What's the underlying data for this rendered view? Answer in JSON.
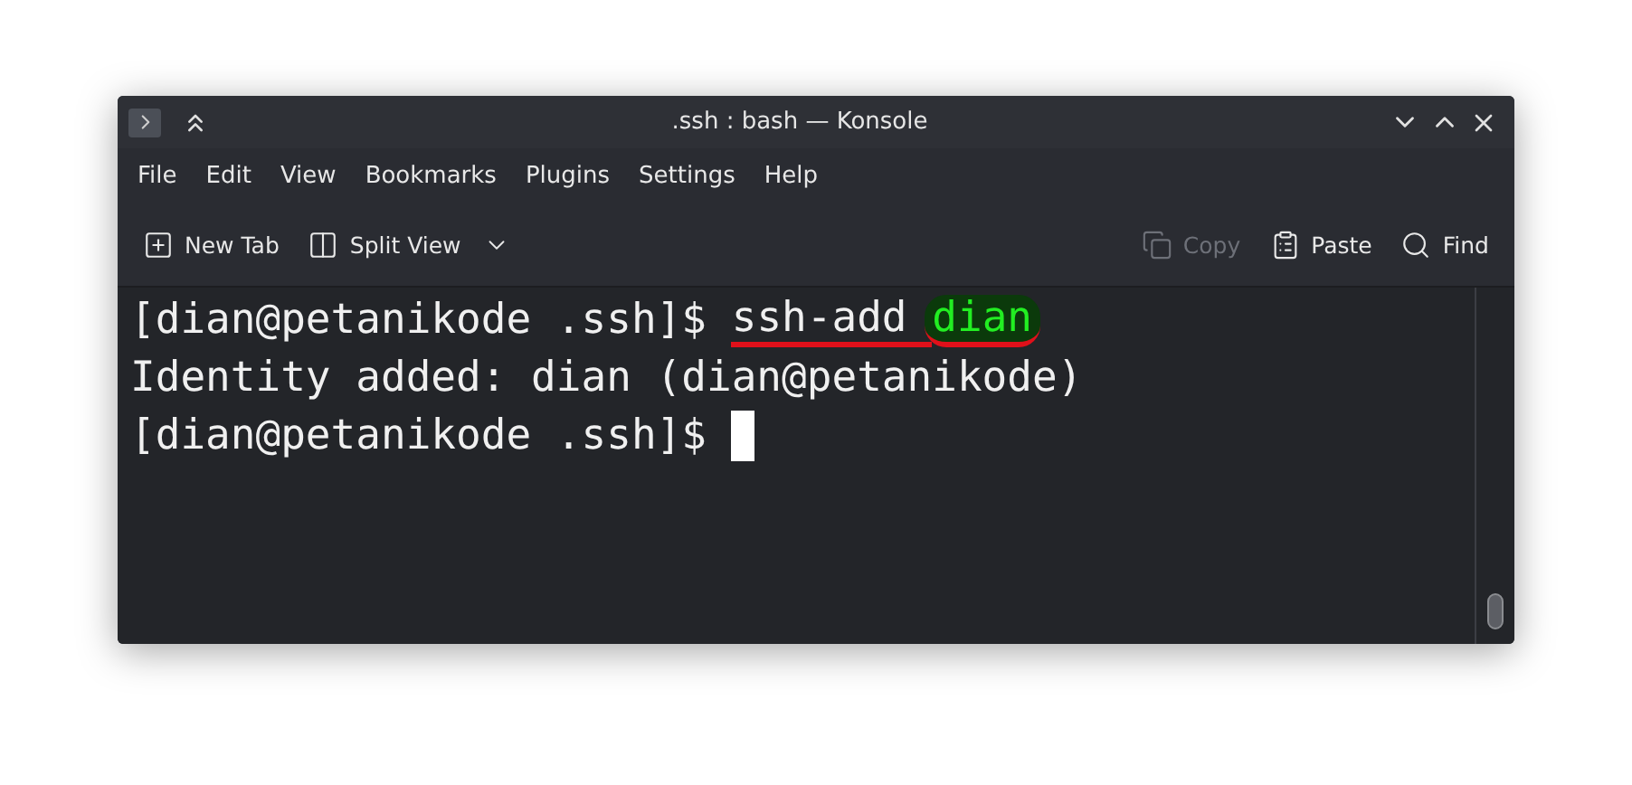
{
  "window": {
    "title": ".ssh : bash — Konsole"
  },
  "menu": [
    "File",
    "Edit",
    "View",
    "Bookmarks",
    "Plugins",
    "Settings",
    "Help"
  ],
  "toolbar_left": [
    {
      "kind": "new-tab",
      "label": "New Tab",
      "disabled": false
    },
    {
      "kind": "split",
      "label": "Split View",
      "disabled": false
    }
  ],
  "toolbar_right": [
    {
      "kind": "copy",
      "label": "Copy",
      "disabled": true
    },
    {
      "kind": "paste",
      "label": "Paste",
      "disabled": false
    },
    {
      "kind": "find",
      "label": "Find",
      "disabled": false
    }
  ],
  "terminal": {
    "lines": [
      {
        "segments": [
          {
            "kind": "prompt",
            "text": "[dian@petanikode .ssh]$"
          },
          {
            "kind": "underlined",
            "text": "ssh-add"
          },
          {
            "kind": "highlighted",
            "text": "dian"
          }
        ]
      },
      {
        "segments": [
          {
            "kind": "output",
            "text": "Identity added: dian (dian@petanikode)"
          }
        ]
      },
      {
        "segments": [
          {
            "kind": "prompt",
            "text": "[dian@petanikode .ssh]$"
          }
        ],
        "cursor": true
      }
    ]
  }
}
